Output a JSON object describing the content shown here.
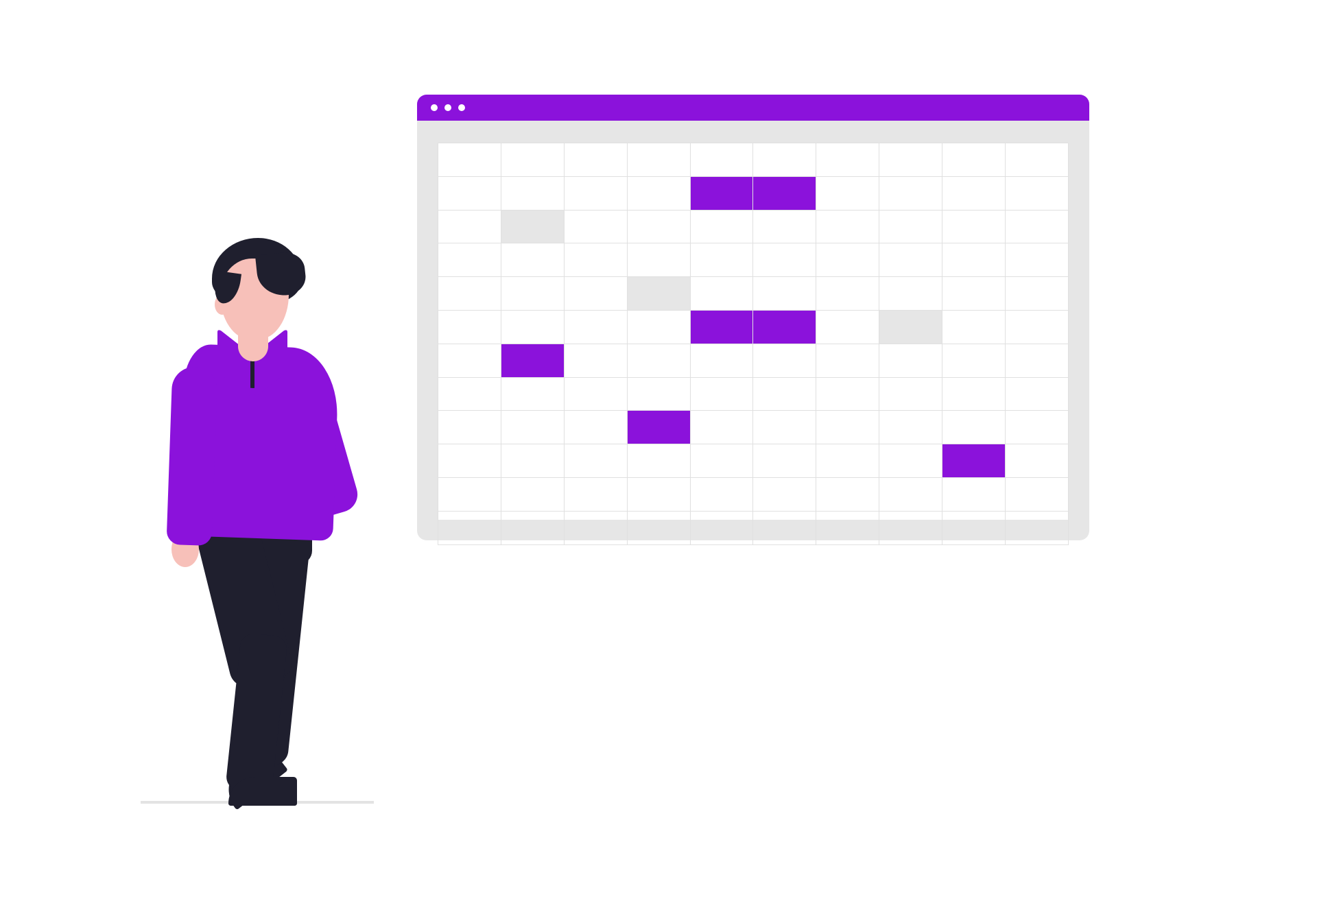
{
  "colors": {
    "accent": "#8b12db",
    "grid_border": "#e0e0e0",
    "window_bg": "#e6e6e6",
    "grey_cell": "#e6e6e6",
    "dark": "#1f1f2e",
    "skin": "#f7c0b9"
  },
  "spreadsheet": {
    "rows": 12,
    "cols": 10,
    "purple_cells": [
      {
        "row": 1,
        "col": 4
      },
      {
        "row": 1,
        "col": 5
      },
      {
        "row": 5,
        "col": 4
      },
      {
        "row": 5,
        "col": 5
      },
      {
        "row": 6,
        "col": 1
      },
      {
        "row": 8,
        "col": 3
      },
      {
        "row": 9,
        "col": 8
      }
    ],
    "grey_cells": [
      {
        "row": 2,
        "col": 1
      },
      {
        "row": 4,
        "col": 3
      },
      {
        "row": 5,
        "col": 7
      }
    ]
  }
}
